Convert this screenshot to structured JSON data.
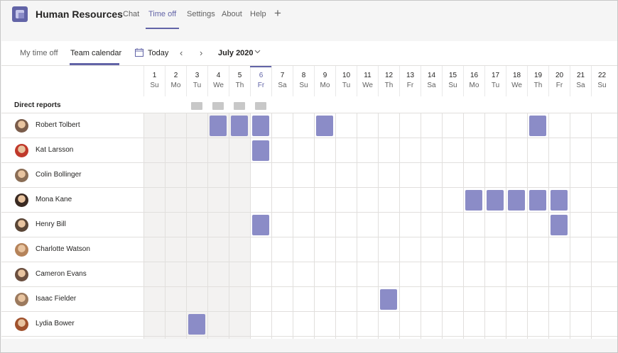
{
  "header": {
    "app_title": "Human Resources",
    "tabs": [
      {
        "label": "Chat"
      },
      {
        "label": "Time off"
      },
      {
        "label": "Settings"
      },
      {
        "label": "About"
      },
      {
        "label": "Help"
      }
    ],
    "active_tab": "Time off",
    "add_tab_glyph": "+"
  },
  "toolbar": {
    "subtabs": [
      {
        "label": "My time off"
      },
      {
        "label": "Team calendar"
      }
    ],
    "today_label": "Today",
    "prev_glyph": "‹",
    "next_glyph": "›",
    "month_label": "July 2020"
  },
  "calendar": {
    "days": [
      {
        "num": "1",
        "dow": "Su"
      },
      {
        "num": "2",
        "dow": "Mo"
      },
      {
        "num": "3",
        "dow": "Tu"
      },
      {
        "num": "4",
        "dow": "We"
      },
      {
        "num": "5",
        "dow": "Th"
      },
      {
        "num": "6",
        "dow": "Fr"
      },
      {
        "num": "7",
        "dow": "Sa"
      },
      {
        "num": "8",
        "dow": "Su"
      },
      {
        "num": "9",
        "dow": "Mo"
      },
      {
        "num": "10",
        "dow": "Tu"
      },
      {
        "num": "11",
        "dow": "We"
      },
      {
        "num": "12",
        "dow": "Th"
      },
      {
        "num": "13",
        "dow": "Fr"
      },
      {
        "num": "14",
        "dow": "Sa"
      },
      {
        "num": "15",
        "dow": "Su"
      },
      {
        "num": "16",
        "dow": "Mo"
      },
      {
        "num": "17",
        "dow": "Tu"
      },
      {
        "num": "18",
        "dow": "We"
      },
      {
        "num": "19",
        "dow": "Th"
      },
      {
        "num": "20",
        "dow": "Fr"
      },
      {
        "num": "21",
        "dow": "Sa"
      },
      {
        "num": "22",
        "dow": "Su"
      }
    ],
    "today_day": "6",
    "section_label": "Direct reports",
    "people": [
      {
        "name": "Robert Tolbert",
        "off_days": [
          "4",
          "5",
          "6",
          "9",
          "19"
        ]
      },
      {
        "name": "Kat Larsson",
        "off_days": [
          "6"
        ]
      },
      {
        "name": "Colin Bollinger",
        "off_days": []
      },
      {
        "name": "Mona Kane",
        "off_days": [
          "16",
          "17",
          "18",
          "19",
          "20"
        ]
      },
      {
        "name": "Henry Bill",
        "off_days": [
          "6",
          "20"
        ]
      },
      {
        "name": "Charlotte Watson",
        "off_days": []
      },
      {
        "name": "Cameron Evans",
        "off_days": []
      },
      {
        "name": "Isaac Fielder",
        "off_days": [
          "12"
        ]
      },
      {
        "name": "Lydia Bower",
        "off_days": [
          "3"
        ]
      }
    ]
  },
  "colors": {
    "accent": "#6264a7",
    "time_off_block": "#8b8cc7"
  }
}
